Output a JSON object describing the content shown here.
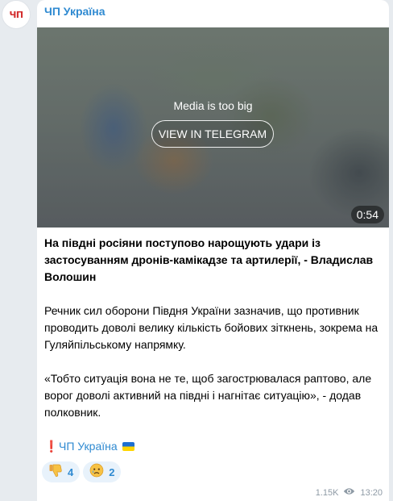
{
  "avatar": {
    "text": "ЧП"
  },
  "post": {
    "channel_name": "ЧП Україна",
    "media": {
      "message": "Media is too big",
      "button_label": "VIEW IN TELEGRAM",
      "duration": "0:54"
    },
    "headline": "На півдні росіяни поступово нарощують удари із застосуванням дронів-камікадзе та артилерії, - Владислав Волошин",
    "paragraph1": "Речник сил оборони Півдня України зазначив, що противник проводить доволі велику кількість бойових зіткнень, зокрема на Гуляйпільському напрямку.",
    "paragraph2": "«Тобто ситуація вона не те, щоб загострювалася раптово, але ворог доволі активний на півдні і нагнітає ситуацію», - додав полковник.",
    "signature": {
      "mark": "❗",
      "label": "ЧП Україна",
      "flag": "ukraine-flag"
    },
    "reactions": [
      {
        "icon": "thumbs-down-icon",
        "count": "4"
      },
      {
        "icon": "sad-face-icon",
        "count": "2"
      }
    ],
    "views": "1.15K",
    "views_icon": "eye-icon",
    "time": "13:20"
  },
  "colors": {
    "accent": "#2f8ad1",
    "brand_red": "#d32f2f",
    "background": "#e7ebef"
  }
}
